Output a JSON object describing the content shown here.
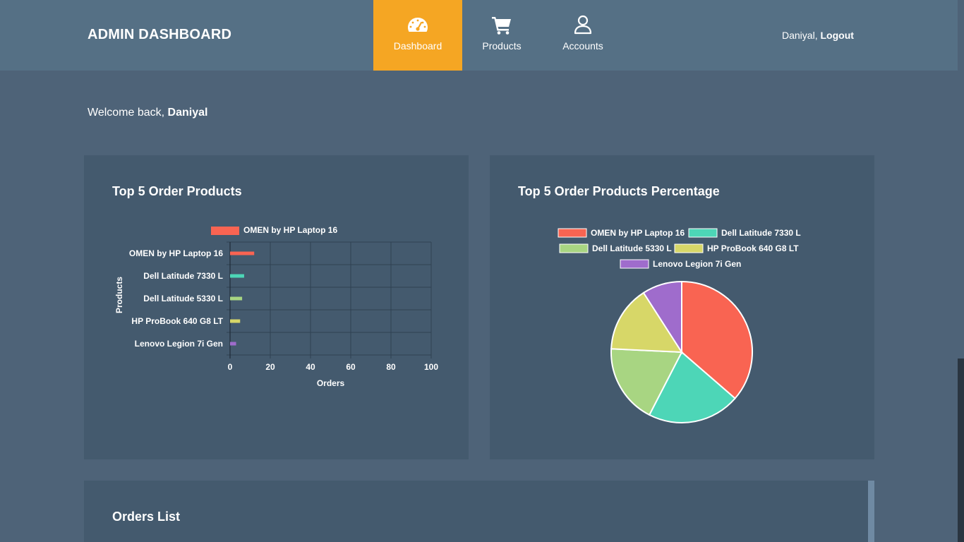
{
  "header": {
    "brand": "ADMIN DASHBOARD",
    "nav": [
      {
        "label": "Dashboard",
        "icon": "speedometer-icon",
        "active": true
      },
      {
        "label": "Products",
        "icon": "cart-icon",
        "active": false
      },
      {
        "label": "Accounts",
        "icon": "user-icon",
        "active": false
      }
    ],
    "user_name": "Daniyal,",
    "logout_label": "Logout"
  },
  "welcome": {
    "prefix": "Welcome back,",
    "name": "Daniyal"
  },
  "colors": {
    "accent": "#f5a623",
    "series": [
      "#f96452",
      "#4dd6b7",
      "#a8d582",
      "#d7d768",
      "#9f6ccc"
    ]
  },
  "cards": {
    "bar_title": "Top 5 Order Products",
    "pie_title": "Top 5 Order Products Percentage",
    "orders_title": "Orders List"
  },
  "chart_data": [
    {
      "type": "bar",
      "orientation": "horizontal",
      "title": "",
      "categories": [
        "OMEN by HP Laptop 16",
        "Dell Latitude 7330 L",
        "Dell Latitude 5330 L",
        "HP ProBook 640 G8 LT",
        "Lenovo Legion 7i Gen"
      ],
      "values": [
        12,
        7,
        6,
        5,
        3
      ],
      "legend": [
        "OMEN by HP Laptop 16"
      ],
      "legend_position": "top",
      "xlabel": "Orders",
      "ylabel": "Products",
      "xlim": [
        0,
        100
      ],
      "xticks": [
        0,
        20,
        40,
        60,
        80,
        100
      ],
      "grid": true
    },
    {
      "type": "pie",
      "title": "",
      "labels": [
        "OMEN by HP Laptop 16",
        "Dell Latitude 7330 L",
        "Dell Latitude 5330 L",
        "HP ProBook 640 G8 LT",
        "Lenovo Legion 7i Gen"
      ],
      "values": [
        12,
        7,
        6,
        5,
        3
      ],
      "legend_position": "top"
    }
  ]
}
